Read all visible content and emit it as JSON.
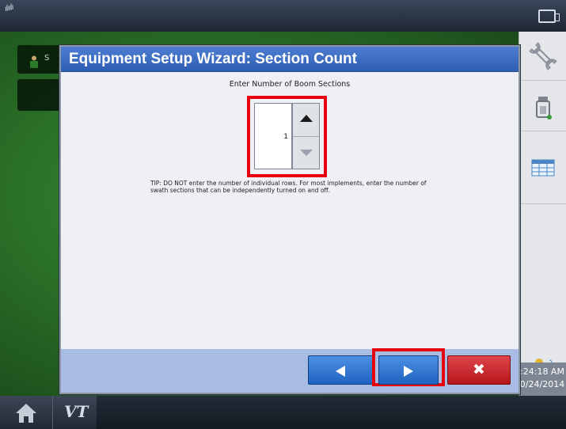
{
  "topbar": {
    "gps_icon": "satellite-signal-icon",
    "camera_icon": "camera-icon"
  },
  "background": {
    "operator_label": "S",
    "operator_icon": "operator-person-icon"
  },
  "sidebar": {
    "items": [
      {
        "icon": "wrench-icon"
      },
      {
        "icon": "implement-icon"
      },
      {
        "icon": "table-icon"
      },
      {
        "icon": "weather-icon"
      }
    ],
    "clock_time": ":24:18 AM",
    "clock_date": "0/24/2014"
  },
  "bottombar": {
    "home_icon": "home-icon",
    "vt_label": "VT"
  },
  "dialog": {
    "title": "Equipment Setup Wizard:  Section Count",
    "prompt": "Enter Number of Boom Sections",
    "section_count": "1",
    "tip": "TIP:  DO NOT enter the number of individual rows.  For most implements, enter the number of swath sections that can be independently turned on and off.",
    "buttons": {
      "back": "back-arrow-icon",
      "next": "next-arrow-icon",
      "cancel": "✖"
    }
  },
  "colors": {
    "title_bar": "#3a6cc4",
    "button_blue": "#2f74d0",
    "button_red": "#cc2026",
    "highlight": "#e8000f",
    "footer": "#a9bce3"
  }
}
